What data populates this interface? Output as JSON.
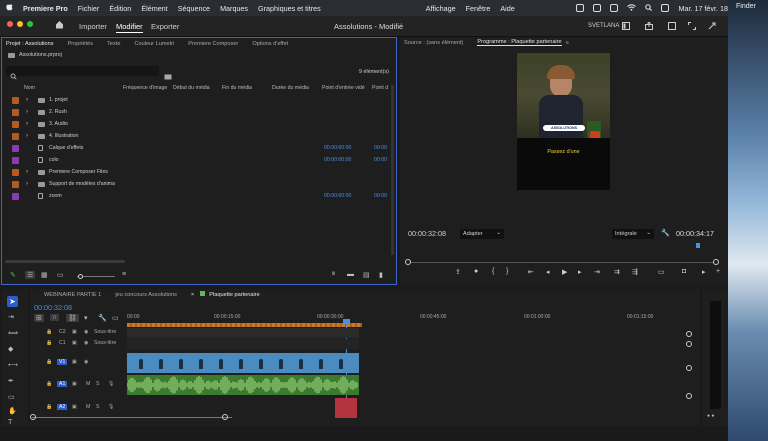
{
  "menubar": {
    "apple": "",
    "app": "Premiere Pro",
    "items": [
      "Fichier",
      "Édition",
      "Élément",
      "Séquence",
      "Marques",
      "Graphiques et titres",
      "Affichage",
      "Fenêtre",
      "Aide"
    ],
    "datetime": "Mar. 17 févr. 18:35",
    "finder": "Finder"
  },
  "header": {
    "import": "Importer",
    "edit": "Modifier",
    "export": "Exporter",
    "title": "Assolutions - Modifié",
    "user": "SVETLANA"
  },
  "project": {
    "tabs": [
      "Projet : Assolutions",
      "Propriétés",
      "Texte",
      "Couleur Lumetri",
      "Premiere Composer",
      "Options d'effet"
    ],
    "file": "Assolutions.prproj",
    "count": "9 élément(s)",
    "columns": [
      "Nom",
      "Fréquence d'image",
      "Début du média",
      "Fin du média",
      "Durée du média",
      "Point d'entrée vidé",
      "Point d"
    ],
    "items": [
      {
        "name": "1. projet",
        "color": "#b35a23",
        "type": "folder",
        "in": "",
        "out": ""
      },
      {
        "name": "2. Rush",
        "color": "#b35a23",
        "type": "folder",
        "in": "",
        "out": ""
      },
      {
        "name": "3. Audio",
        "color": "#b35a23",
        "type": "folder",
        "in": "",
        "out": ""
      },
      {
        "name": "4. Illustration",
        "color": "#b35a23",
        "type": "folder",
        "in": "",
        "out": ""
      },
      {
        "name": "Calque d'effets",
        "color": "#8a3bb3",
        "type": "file",
        "in": "00:00:00:00",
        "out": "00:00"
      },
      {
        "name": "colo",
        "color": "#8a3bb3",
        "type": "file",
        "in": "00:00:00:00",
        "out": "00:00"
      },
      {
        "name": "Premiere Composer Files",
        "color": "#b35a23",
        "type": "folder",
        "in": "",
        "out": ""
      },
      {
        "name": "Support de modèles d'anima",
        "color": "#b35a23",
        "type": "folder",
        "in": "",
        "out": ""
      },
      {
        "name": "zoom",
        "color": "#8a3bb3",
        "type": "file",
        "in": "00:00:00:00",
        "out": "00:00"
      }
    ]
  },
  "program": {
    "source_tab": "Source : (sans élément)",
    "program_tab": "Programme : Plaquette partenaire",
    "caption_logo": "ASSOLUTIONS",
    "caption": "Passez d'une",
    "timecode": "00:00:32:08",
    "fit": "Adapter",
    "quality": "Intégrale",
    "duration": "00:00:34:17"
  },
  "timeline": {
    "tabs": [
      "WEBINAIRE PARTIE 1",
      "jeu concours Assolutions",
      "Plaquette partenaire"
    ],
    "timecode": "00:00:32:08",
    "ruler": [
      "00:00",
      "00:00:15:00",
      "00:00:30:00",
      "00:00:45:00",
      "00:01:00:00",
      "00:01:15:00"
    ],
    "tracks": [
      {
        "id": "C2",
        "label": "Sous-titre"
      },
      {
        "id": "C1",
        "label": "Sous-titre"
      },
      {
        "id": "V1",
        "label": ""
      },
      {
        "id": "A1",
        "label": ""
      },
      {
        "id": "A2",
        "label": ""
      }
    ],
    "track_letters": {
      "m": "M",
      "s": "S"
    }
  }
}
